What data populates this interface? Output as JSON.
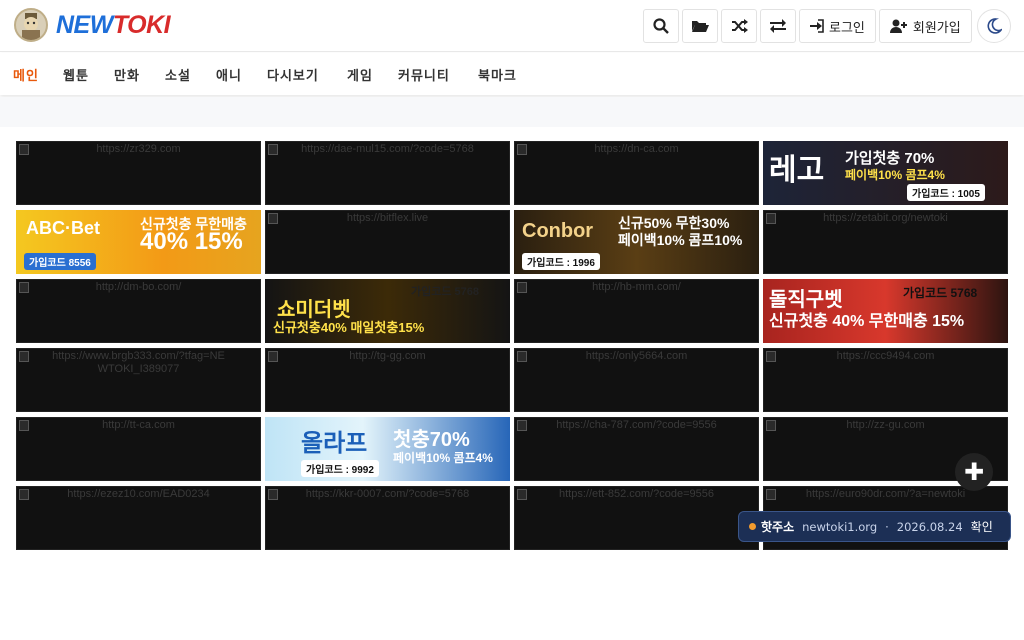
{
  "brand": {
    "name_part1": "NEW",
    "name_part2": "TOKI"
  },
  "toolbar": {
    "login_label": "로그인",
    "signup_label": "회원가입"
  },
  "nav": {
    "items": [
      "메인",
      "웹툰",
      "만화",
      "소설",
      "애니",
      "다시보기",
      "게임",
      "커뮤니티",
      "북마크"
    ]
  },
  "tiles": [
    {
      "url": "https://zr329.com"
    },
    {
      "url": "https://dae-mul15.com/?code=5768"
    },
    {
      "url": "https://dn-ca.com"
    },
    {
      "ad": "lego",
      "line1": "레고",
      "line2": "가입첫충 70%",
      "line3": "페이백10% 콤프4%",
      "code": "가입코드 : 1005"
    },
    {
      "ad": "abc",
      "line1": "ABC·Bet",
      "line2": "신규첫충 무한매충",
      "line3": "40% 15%",
      "code": "가입코드 8556"
    },
    {
      "url": "https://bitflex.live"
    },
    {
      "ad": "conbor",
      "line1": "Conbor",
      "line2": "신규50% 무한30%",
      "line3": "페이백10% 콤프10%",
      "code": "가입코드 : 1996"
    },
    {
      "url": "https://zetabit.org/newtoki"
    },
    {
      "url": "http://dm-bo.com/"
    },
    {
      "ad": "show",
      "line1": "쇼미더벳",
      "line2": "가입코드 5768",
      "line3": "신규첫충40% 매일첫충15%",
      "code": ""
    },
    {
      "url": "http://hb-mm.com/"
    },
    {
      "ad": "dol",
      "line1": "돌직구벳",
      "line2": "가입코드 5768",
      "line3": "신규첫충 40% 무한매충 15%",
      "code": ""
    },
    {
      "url": "https://www.brgb333.com/?tfag=NEWTOKI_I389077"
    },
    {
      "url": "http://tg-gg.com"
    },
    {
      "url": "https://only5664.com"
    },
    {
      "url": "https://ccc9494.com"
    },
    {
      "url": "http://tt-ca.com"
    },
    {
      "ad": "olaf",
      "line1": "올라프",
      "line2": "첫충70%",
      "line3": "페이백10% 콤프4%",
      "code": "가입코드 : 9992"
    },
    {
      "url": "https://cha-787.com/?code=9556"
    },
    {
      "url": "http://zz-gu.com"
    },
    {
      "url": "https://ezez10.com/EAD0234"
    },
    {
      "url": "https://kkr-0007.com/?code=5768"
    },
    {
      "url": "https://ett-852.com/?code=9556"
    },
    {
      "url": "https://euro90dr.com/?a=newtoki"
    }
  ],
  "notice": {
    "label": "핫주소",
    "domain": "newtoki1.org",
    "separator": "·",
    "date": "2026.08.24",
    "action": "확인"
  },
  "colors": {
    "accent": "#e8590c",
    "brand_blue": "#1e6fd9",
    "brand_red": "#d82b2b",
    "notice_bg": "#1c2f55"
  }
}
